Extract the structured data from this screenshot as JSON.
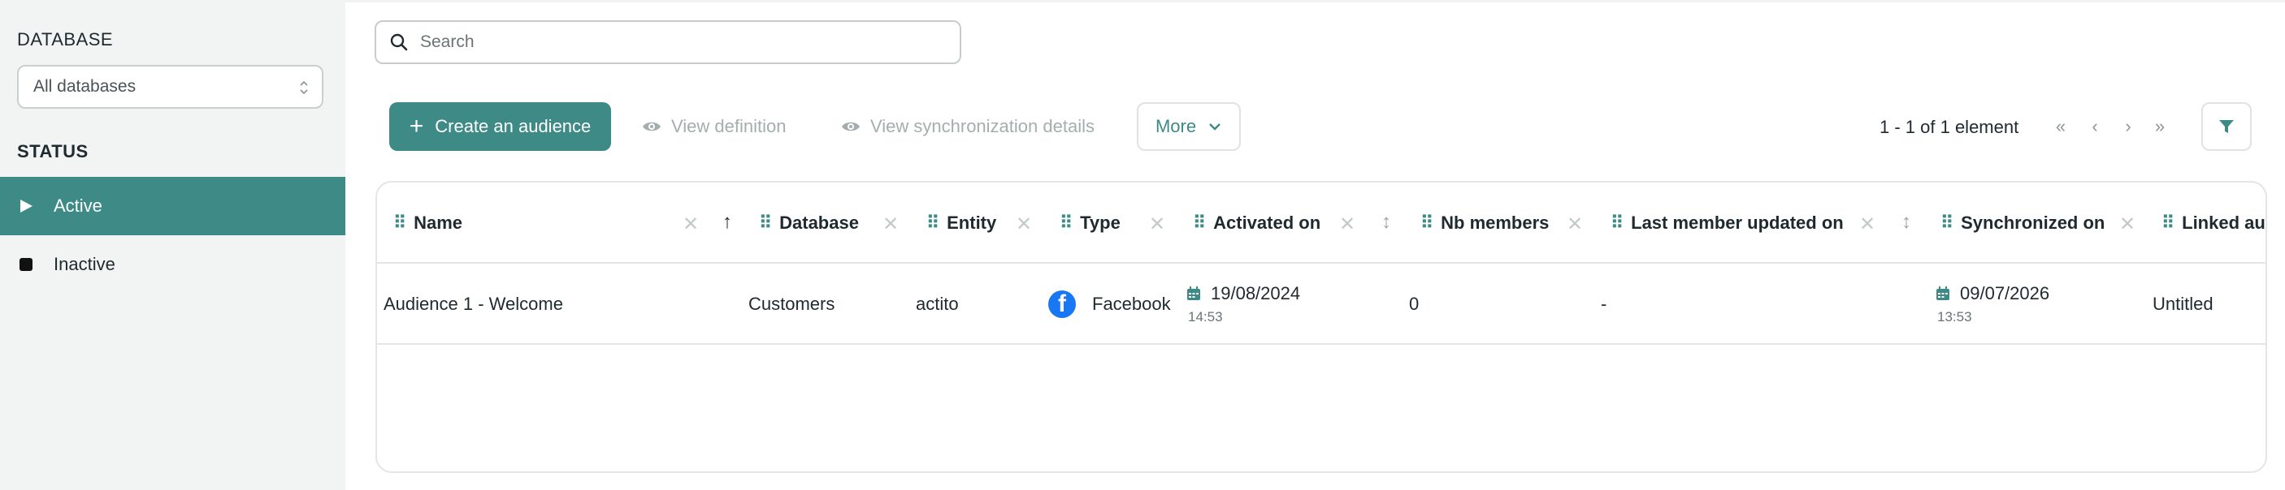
{
  "sidebar": {
    "database_label": "DATABASE",
    "database_select_value": "All databases",
    "status_label": "STATUS",
    "items": [
      {
        "label": "Active",
        "icon": "play-icon",
        "selected": true
      },
      {
        "label": "Inactive",
        "icon": "stop-icon",
        "selected": false
      }
    ]
  },
  "search": {
    "placeholder": "Search",
    "value": ""
  },
  "toolbar": {
    "create_label": "Create an audience",
    "view_definition_label": "View definition",
    "view_sync_label": "View synchronization details",
    "more_label": "More",
    "pager_text": "1 - 1 of 1 element",
    "pager_first": "«",
    "pager_prev": "‹",
    "pager_next": "›",
    "pager_last": "»"
  },
  "table": {
    "columns": [
      {
        "label": "Name"
      },
      {
        "label": "Database"
      },
      {
        "label": "Entity"
      },
      {
        "label": "Type"
      },
      {
        "label": "Activated on"
      },
      {
        "label": "Nb members"
      },
      {
        "label": "Last member updated on"
      },
      {
        "label": "Synchronized on"
      },
      {
        "label": "Linked audience"
      }
    ],
    "rows": [
      {
        "name": "Audience 1 - Welcome",
        "database": "Customers",
        "entity": "actito",
        "type": "Facebook",
        "activated_date": "19/08/2024",
        "activated_time": "14:53",
        "nb_members": "0",
        "last_member_updated": "-",
        "synchronized_date": "09/07/2026",
        "synchronized_time": "13:53",
        "linked": "Untitled"
      }
    ]
  },
  "colors": {
    "accent": "#3d8a86",
    "facebook": "#1877f2"
  }
}
